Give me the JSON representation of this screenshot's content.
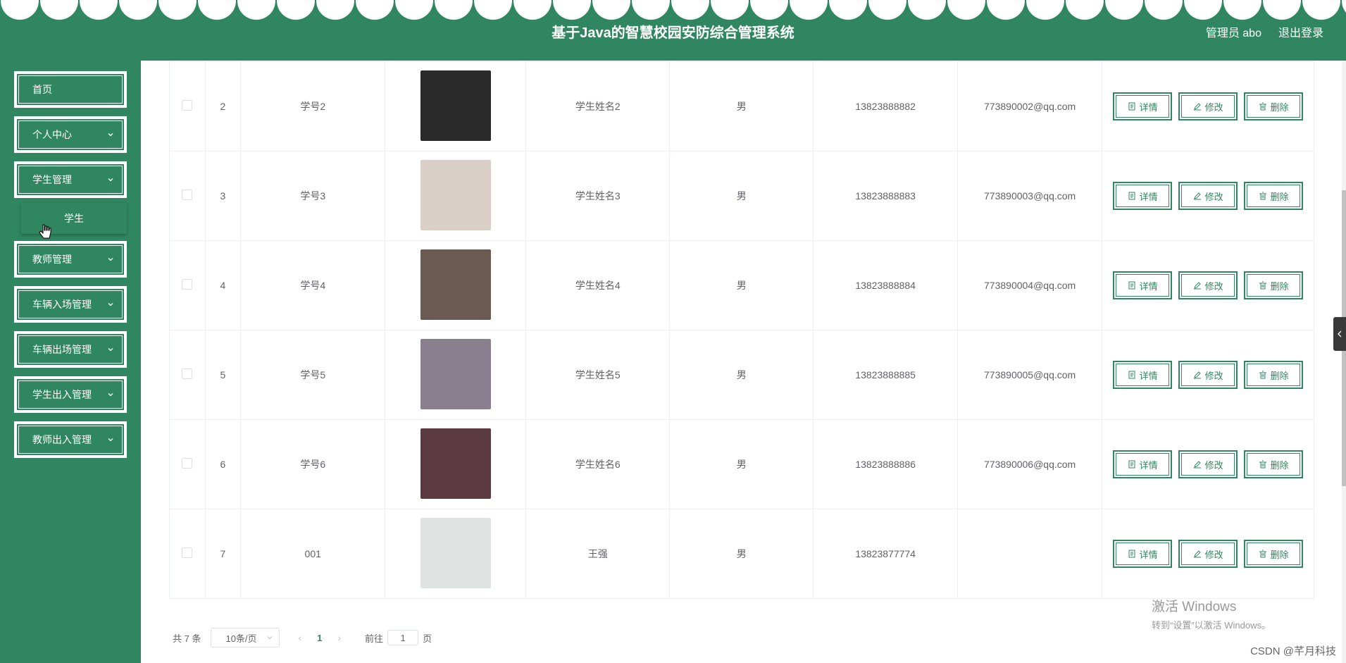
{
  "header": {
    "title": "基于Java的智慧校园安防综合管理系统",
    "user_label": "管理员 abo",
    "logout_label": "退出登录"
  },
  "sidebar": {
    "items": [
      {
        "label": "首页",
        "has_children": false
      },
      {
        "label": "个人中心",
        "has_children": true
      },
      {
        "label": "学生管理",
        "has_children": true
      },
      {
        "label": "教师管理",
        "has_children": true
      },
      {
        "label": "车辆入场管理",
        "has_children": true
      },
      {
        "label": "车辆出场管理",
        "has_children": true
      },
      {
        "label": "学生出入管理",
        "has_children": true
      },
      {
        "label": "教师出入管理",
        "has_children": true
      }
    ],
    "submenu_label": "学生"
  },
  "actions": {
    "detail_label": "详情",
    "edit_label": "修改",
    "delete_label": "删除"
  },
  "table": {
    "rows": [
      {
        "index": "2",
        "student_no": "学号2",
        "name": "学生姓名2",
        "gender": "男",
        "phone": "13823888882",
        "email": "773890002@qq.com",
        "photo_color": "#2a2a2a"
      },
      {
        "index": "3",
        "student_no": "学号3",
        "name": "学生姓名3",
        "gender": "男",
        "phone": "13823888883",
        "email": "773890003@qq.com",
        "photo_color": "#d9cfc6"
      },
      {
        "index": "4",
        "student_no": "学号4",
        "name": "学生姓名4",
        "gender": "男",
        "phone": "13823888884",
        "email": "773890004@qq.com",
        "photo_color": "#6b5a52"
      },
      {
        "index": "5",
        "student_no": "学号5",
        "name": "学生姓名5",
        "gender": "男",
        "phone": "13823888885",
        "email": "773890005@qq.com",
        "photo_color": "#8a7f8f"
      },
      {
        "index": "6",
        "student_no": "学号6",
        "name": "学生姓名6",
        "gender": "男",
        "phone": "13823888886",
        "email": "773890006@qq.com",
        "photo_color": "#5a3a40"
      },
      {
        "index": "7",
        "student_no": "001",
        "name": "王强",
        "gender": "男",
        "phone": "13823877774",
        "email": "",
        "photo_color": "#dfe4e2"
      }
    ]
  },
  "pagination": {
    "total_label": "共 7 条",
    "page_size": "10条/页",
    "current_page": "1",
    "goto_label": "前往",
    "goto_value": "1",
    "page_unit": "页"
  },
  "watermark": {
    "title": "激活 Windows",
    "subtitle": "转到“设置”以激活 Windows。",
    "credit": "CSDN @芊月科技"
  },
  "colors": {
    "primary": "#2f8660",
    "border": "#ebeef5"
  }
}
